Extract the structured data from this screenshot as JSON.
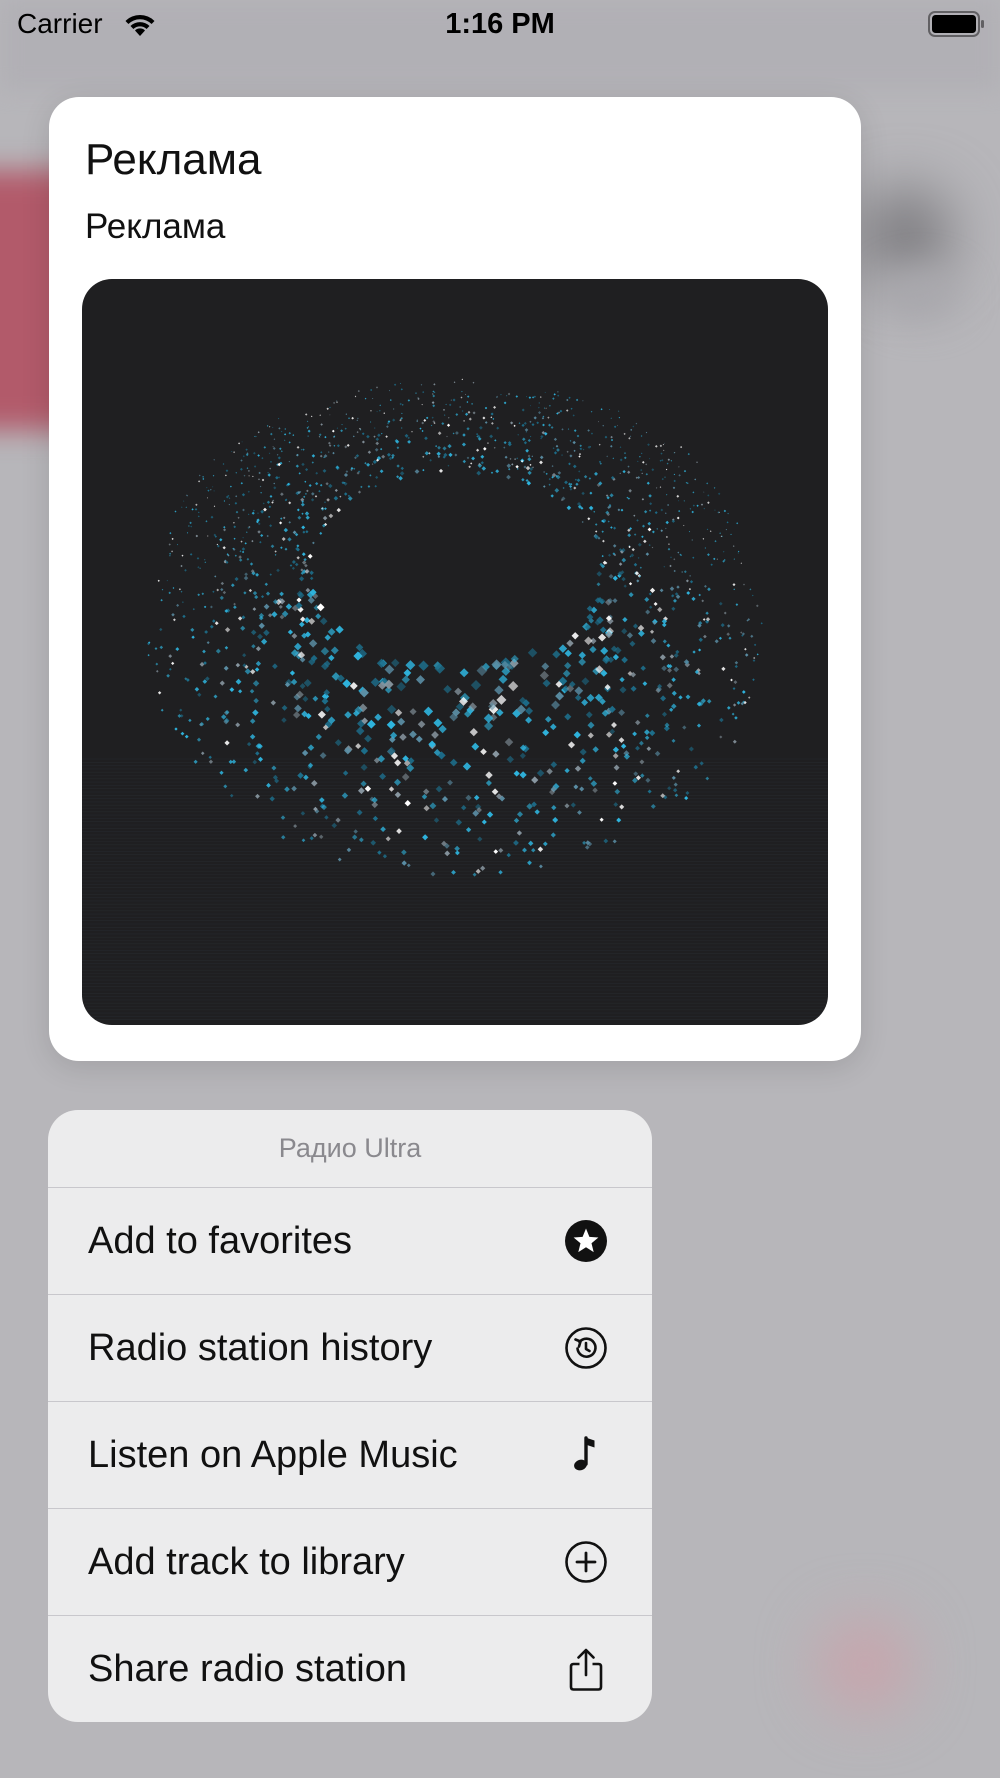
{
  "status_bar": {
    "carrier": "Carrier",
    "time": "1:16 PM",
    "icons": [
      "wifi-icon",
      "battery-icon"
    ]
  },
  "preview": {
    "title": "Реклама",
    "subtitle": "Реклама",
    "artwork": "dark square with a ring of cyan, grey and white dots"
  },
  "menu": {
    "header": "Радио Ultra",
    "items": [
      {
        "label": "Add to favorites",
        "icon": "star-circle-icon"
      },
      {
        "label": "Radio station history",
        "icon": "history-icon"
      },
      {
        "label": "Listen on Apple Music",
        "icon": "music-note-icon"
      },
      {
        "label": "Add track to library",
        "icon": "plus-circle-icon"
      },
      {
        "label": "Share radio station",
        "icon": "share-icon"
      }
    ]
  },
  "colors": {
    "backdrop": "#b7b6ba",
    "card": "#ffffff",
    "menu": "#ececed",
    "artwork_bg": "#1f1f21",
    "accent_cyan": "#2fb6e0"
  }
}
